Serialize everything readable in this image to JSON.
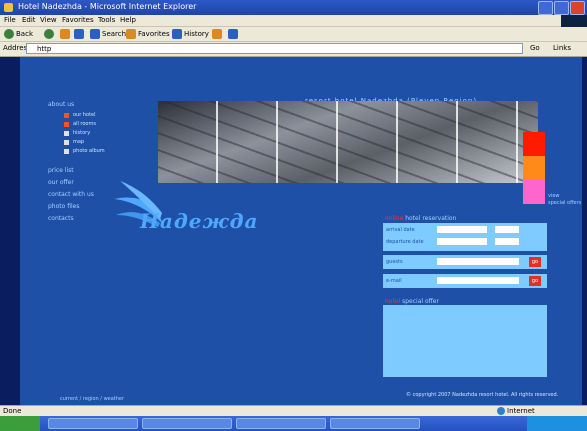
{
  "window": {
    "title": "Hotel Nadezhda - Microsoft Internet Explorer"
  },
  "menu": [
    "File",
    "Edit",
    "View",
    "Favorites",
    "Tools",
    "Help"
  ],
  "toolbar": {
    "back": "Back",
    "search": "Search",
    "favorites": "Favorites",
    "history": "History"
  },
  "address": {
    "label": "Address",
    "value": "http",
    "go": "Go",
    "links": "Links"
  },
  "site": {
    "banner_title": "resort hotel Nadezhda (Pleven Region)",
    "logo": "Надежда",
    "nav": {
      "about": "about us",
      "sub": [
        "our hotel",
        "all rooms",
        "history",
        "map",
        "photo album"
      ],
      "items": [
        "price list",
        "our offer",
        "contact with us",
        "photo files",
        "contacts"
      ]
    },
    "promo": [
      "view",
      "special offers"
    ],
    "swatch_colors": [
      "#ff1a00",
      "#ff8a1a",
      "#ff66cc"
    ],
    "reservation": {
      "title_hl": "online",
      "title": "hotel reservation",
      "fields": [
        "arrival date",
        "departure date"
      ],
      "guests_label": "guests",
      "email_label": "e-mail",
      "go": "go"
    },
    "special": {
      "title_hl": "hotel",
      "title": "special offer"
    },
    "footer": {
      "left": "current / region / weather",
      "copyright": "© copyright 2007 Nadezhda resort hotel. All rights reserved."
    }
  },
  "status": {
    "left": "Done",
    "zone": "Internet"
  }
}
